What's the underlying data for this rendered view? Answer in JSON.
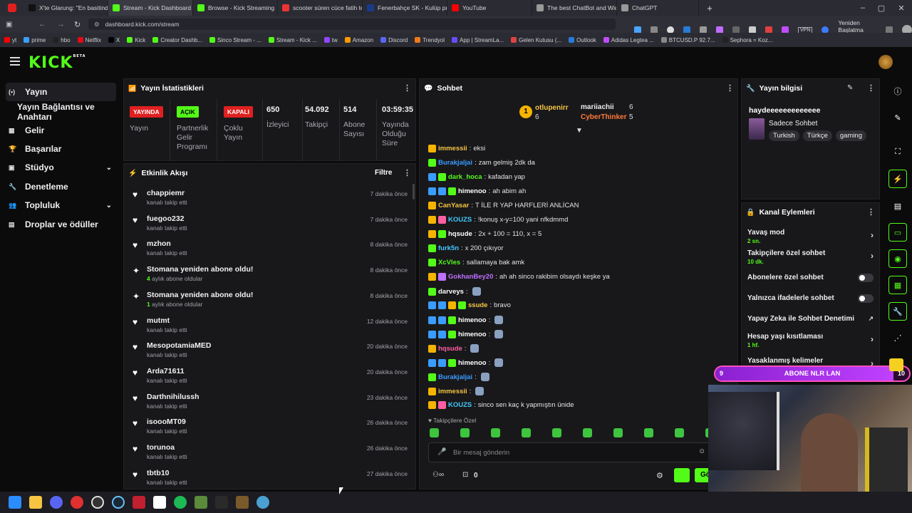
{
  "browser": {
    "tabs": [
      {
        "label": "X'te Glarung: \"En basitinde",
        "color": "#111"
      },
      {
        "label": "Stream - Kick Dashboard",
        "color": "#53fc18"
      },
      {
        "label": "Browse - Kick Streaming",
        "color": "#53fc18"
      },
      {
        "label": "scooter süren cüce fatih te",
        "color": "#e33"
      },
      {
        "label": "Fenerbahçe SK - Kulüp pro",
        "color": "#1a3a8a"
      },
      {
        "label": "YouTube",
        "color": "#f00"
      },
      {
        "label": "The best ChatBot and Widg",
        "color": "#999"
      },
      {
        "label": "ChatGPT",
        "color": "#999"
      }
    ],
    "url": "dashboard.kick.com/stream",
    "restart_label": "Yeniden Başlatma Gerekli",
    "vpn": "VPN",
    "bookmarks": [
      "yt",
      "prime",
      "hbo",
      "Netflix",
      "X",
      "Kick",
      "Creator Dashb...",
      "Sinco Stream - ...",
      "Stream - Kick ...",
      "tw",
      "Amazon",
      "Discord",
      "Trendyol",
      "App | StreamLa...",
      "Gelen Kutusu (...",
      "Outlook",
      "Adidas Legtea ...",
      "BTCUSD.P 92.7...",
      "Sephora = Koz..."
    ]
  },
  "brand": {
    "logo": "KICK",
    "beta": "BETA"
  },
  "sidebar": {
    "items": [
      {
        "label": "Yayın",
        "icon": "broadcast-icon"
      },
      {
        "label": "Yayın Bağlantısı ve Anahtarı",
        "icon": ""
      },
      {
        "label": "Gelir",
        "icon": "chart-icon"
      },
      {
        "label": "Başarılar",
        "icon": "trophy-icon"
      },
      {
        "label": "Stüdyo",
        "icon": "studio-icon"
      },
      {
        "label": "Denetleme",
        "icon": "wrench-icon"
      },
      {
        "label": "Topluluk",
        "icon": "users-icon"
      },
      {
        "label": "Droplar ve ödüller",
        "icon": "gift-icon"
      }
    ]
  },
  "stats": {
    "title": "Yayın İstatistikleri",
    "badges": [
      {
        "badge": "YAYINDA",
        "label": "Yayın",
        "bg": "#e02020",
        "fg": "#fff"
      },
      {
        "badge": "AÇIK",
        "label": "Partnerlik Gelir Programı",
        "bg": "#53fc18",
        "fg": "#000"
      },
      {
        "badge": "KAPALI",
        "label": "Çoklu Yayın",
        "bg": "#e02020",
        "fg": "#fff"
      }
    ],
    "numbers": [
      {
        "value": "650",
        "label": "İzleyici"
      },
      {
        "value": "54.092",
        "label": "Takipçi"
      },
      {
        "value": "514",
        "label": "Abone Sayısı"
      },
      {
        "value": "03:59:35",
        "label": "Yayında Olduğu Süre"
      }
    ]
  },
  "activity": {
    "title": "Etkinlik Akışı",
    "filter": "Filtre",
    "events": [
      {
        "name": "chappiemr",
        "sub": "kanalı takip etti",
        "time": "7 dakika önce",
        "type": "follow"
      },
      {
        "name": "fuegoo232",
        "sub": "kanalı takip etti",
        "time": "7 dakika önce",
        "type": "follow"
      },
      {
        "name": "mzhon",
        "sub": "kanalı takip etti",
        "time": "8 dakika önce",
        "type": "follow"
      },
      {
        "name": "Stomana yeniden abone oldu!",
        "sub_hl": "4",
        "sub": " aylık abone oldular",
        "time": "8 dakika önce",
        "type": "sub"
      },
      {
        "name": "Stomana yeniden abone oldu!",
        "sub_hl": "1",
        "sub": " aylık abone oldular",
        "time": "8 dakika önce",
        "type": "sub"
      },
      {
        "name": "mutmt",
        "sub": "kanalı takip etti",
        "time": "12 dakika önce",
        "type": "follow"
      },
      {
        "name": "MesopotamiaMED",
        "sub": "kanalı takip etti",
        "time": "20 dakika önce",
        "type": "follow"
      },
      {
        "name": "Arda71611",
        "sub": "kanalı takip etti",
        "time": "20 dakika önce",
        "type": "follow"
      },
      {
        "name": "Darthnihilussh",
        "sub": "kanalı takip etti",
        "time": "23 dakika önce",
        "type": "follow"
      },
      {
        "name": "isoooMT09",
        "sub": "kanalı takip etti",
        "time": "26 dakika önce",
        "type": "follow"
      },
      {
        "name": "torunoa",
        "sub": "kanalı takip etti",
        "time": "26 dakika önce",
        "type": "follow"
      },
      {
        "name": "tbtb10",
        "sub": "kanalı takip etti",
        "time": "27 dakika önce",
        "type": "follow"
      }
    ]
  },
  "chat": {
    "title": "Sohbet",
    "leaders": [
      {
        "name": "otlupenirr",
        "count": "6",
        "rank": "1"
      },
      {
        "name": "mariiachii",
        "count": "6"
      },
      {
        "name": "CyberThinker",
        "count": "5"
      }
    ],
    "messages": [
      {
        "user": "immessii",
        "color": "#f5c542",
        "text": "eksi"
      },
      {
        "user": "Burakjaljai",
        "color": "#3b9cff",
        "text": "zam gelmiş 2dk da"
      },
      {
        "user": "dark_hoca",
        "color": "#53fc18",
        "text": "kafadan yap"
      },
      {
        "user": "himenoo",
        "color": "#ffffff",
        "text": "ah abim ah"
      },
      {
        "user": "CanYasar",
        "color": "#f5c542",
        "text": "T İLE R YAP HARFLERİ ANLİCAN"
      },
      {
        "user": "KOUZS",
        "color": "#40c8ff",
        "text": "!konuş x-y=100 yani nfkdmmd"
      },
      {
        "user": "hqsude",
        "color": "#ffffff",
        "text": "2x + 100 = 110, x = 5"
      },
      {
        "user": "furk5n",
        "color": "#40c8ff",
        "text": "x 200 çıkıyor"
      },
      {
        "user": "XcVles",
        "color": "#53fc18",
        "text": "sallamaya bak amk"
      },
      {
        "user": "GokhanBey20",
        "color": "#c070ff",
        "text": "ah ah sinco rakibim olsaydı keşke ya"
      },
      {
        "user": "darveys",
        "color": "#ffffff",
        "text": ""
      },
      {
        "user": "ssude",
        "color": "#f5c542",
        "text": "bravo"
      },
      {
        "user": "himenoo",
        "color": "#ffffff",
        "text": ""
      },
      {
        "user": "himenoo",
        "color": "#ffffff",
        "text": ""
      },
      {
        "user": "hqsude",
        "color": "#ff5fa0",
        "text": ""
      },
      {
        "user": "himenoo",
        "color": "#ffffff",
        "text": ""
      },
      {
        "user": "Burakjaljai",
        "color": "#3b9cff",
        "text": ""
      },
      {
        "user": "immessii",
        "color": "#f5c542",
        "text": ""
      },
      {
        "user": "KOUZS",
        "color": "#40c8ff",
        "text": "sinco sen kaç k yapmıştın ünide"
      }
    ],
    "followers_only": "Takipçilere Özel",
    "placeholder": "Bir mesaj gönderin",
    "count": "0",
    "send": "Gö"
  },
  "info": {
    "title": "Yayın bilgisi",
    "stream_title": "haydeeeeeeeeeeeee",
    "category": "Sadece Sohbet",
    "tags": [
      "Turkish",
      "Türkçe",
      "gaming"
    ]
  },
  "actions": {
    "title": "Kanal Eylemleri",
    "items": [
      {
        "label": "Yavaş mod",
        "sub": "2 sn.",
        "kind": "chevron"
      },
      {
        "label": "Takipçilere özel sohbet",
        "sub": "10 dk.",
        "kind": "chevron"
      },
      {
        "label": "Abonelere özel sohbet",
        "sub": "",
        "kind": "toggle"
      },
      {
        "label": "Yalnızca ifadelerle sohbet",
        "sub": "",
        "kind": "toggle"
      },
      {
        "label": "Yapay Zeka ile Sohbet Denetimi",
        "sub": "",
        "kind": "ext"
      },
      {
        "label": "Hesap yaşı kısıtlaması",
        "sub": "1 hf.",
        "kind": "chevron"
      },
      {
        "label": "Yasaklanmış kelimeler",
        "sub": "",
        "kind": "chevron"
      }
    ]
  },
  "sub_goal": {
    "left": "9",
    "label": "ABONE NLR LAN",
    "right": "10",
    "progress": 0.92
  },
  "colors": {
    "accent": "#53fc18",
    "bg": "#0b0b0c",
    "panel": "#18181b"
  }
}
